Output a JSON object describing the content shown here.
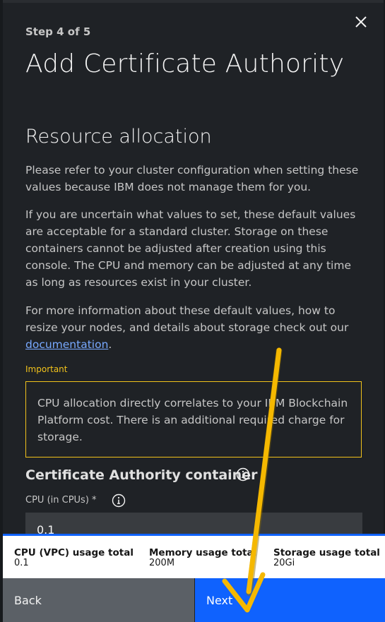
{
  "header": {
    "step": "Step 4 of 5",
    "title": "Add Certificate Authority",
    "close_icon": "close-icon"
  },
  "resource": {
    "heading": "Resource allocation",
    "p1": "Please refer to your cluster configuration when setting these values because IBM does not manage them for you.",
    "p2": "If you are uncertain what values to set, these default values are acceptable for a standard cluster. Storage on these containers cannot be adjusted after creation using this console. The CPU and memory can be adjusted at any time as long as resources exist in your cluster.",
    "p3_prefix": "For more information about these default values, how to resize your nodes, and details about storage check out our ",
    "p3_link": "documentation",
    "p3_suffix": "."
  },
  "important": {
    "label": "Important",
    "text": "CPU allocation directly correlates to your IBM Blockchain Platform cost. There is an additional required charge for storage."
  },
  "ca_container": {
    "heading": "Certificate Authority container",
    "cpu_label": "CPU (in CPUs) *",
    "cpu_value": "0.1"
  },
  "usage": {
    "cpu_title": "CPU (VPC) usage total",
    "cpu_value": "0.1",
    "memory_title": "Memory usage total",
    "memory_value": "200M",
    "storage_title": "Storage usage total",
    "storage_value": "20Gi"
  },
  "buttons": {
    "back": "Back",
    "next": "Next"
  },
  "colors": {
    "panel_bg": "#1f2226",
    "warning": "#f1c21b",
    "primary": "#0f62fe",
    "secondary": "#5b6066",
    "link": "#78a9ff",
    "annotation_arrow": "#f5b800"
  }
}
